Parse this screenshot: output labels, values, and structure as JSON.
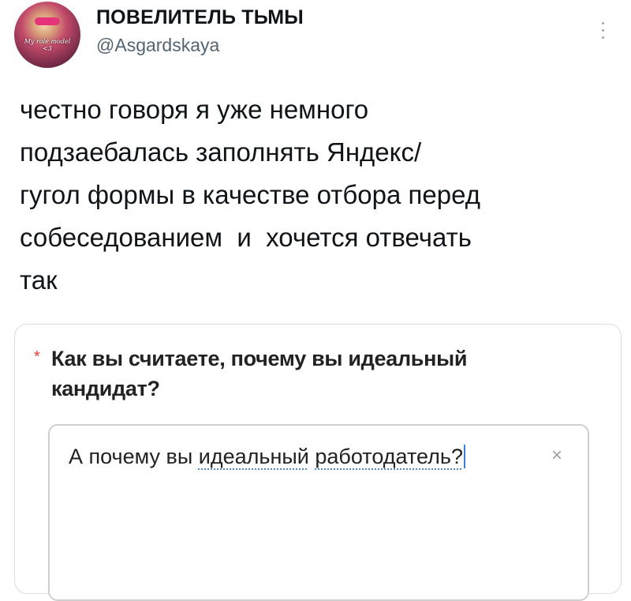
{
  "author": {
    "name": "ПОВЕЛИТЕЛЬ ТЬМЫ",
    "handle": "@Asgardskaya",
    "avatar_caption": "My role model <3"
  },
  "tweet": {
    "lines": [
      "честно говоря я уже немного",
      "подзаебалась заполнять Яндекс/",
      "гугол формы в качестве отбора перед",
      "собеседованием  и  хочется отвечать",
      "так"
    ]
  },
  "form": {
    "required_mark": "*",
    "question": "Как вы считаете, почему вы идеальный кандидат?",
    "answer": {
      "part1": "А почему вы ",
      "part2": "идеальный",
      "part3": " ",
      "part4": "работодатель?"
    },
    "clear_icon": "×"
  },
  "icons": [
    "more-vertical-icon",
    "clear-icon"
  ],
  "colors": {
    "required": "#e53935",
    "caret": "#3b7dd8",
    "handle": "#536471"
  }
}
